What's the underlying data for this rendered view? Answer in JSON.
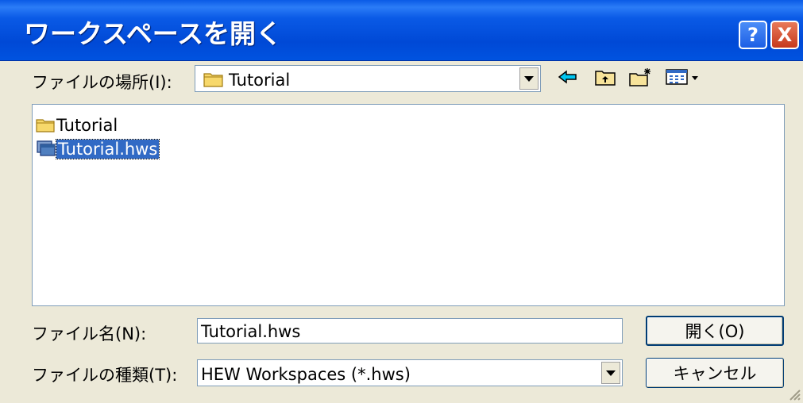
{
  "window": {
    "title": "ワークスペースを開く",
    "help_label": "?",
    "close_label": "X"
  },
  "lookin": {
    "label_text": "ファイルの場所",
    "label_suffix": "(I):",
    "value": "Tutorial"
  },
  "toolbar": {
    "back_icon": "back-arrow-icon",
    "up_icon": "up-folder-icon",
    "newfolder_icon": "new-folder-icon",
    "view_icon": "view-menu-icon"
  },
  "files": [
    {
      "name": "Tutorial",
      "icon": "folder-icon",
      "selected": false
    },
    {
      "name": "Tutorial.hws",
      "icon": "workspace-file-icon",
      "selected": true
    }
  ],
  "filename": {
    "label_text": "ファイル名",
    "label_suffix": "(N):",
    "value": "Tutorial.hws"
  },
  "filetype": {
    "label_text": "ファイルの種類",
    "label_suffix": "(T):",
    "value": "HEW Workspaces (*.hws)"
  },
  "buttons": {
    "open_label": "開く(O)",
    "cancel_label": "キャンセル"
  },
  "colors": {
    "titlebar": "#0a5ae6",
    "selection": "#316ac5",
    "face": "#ece9d8"
  }
}
